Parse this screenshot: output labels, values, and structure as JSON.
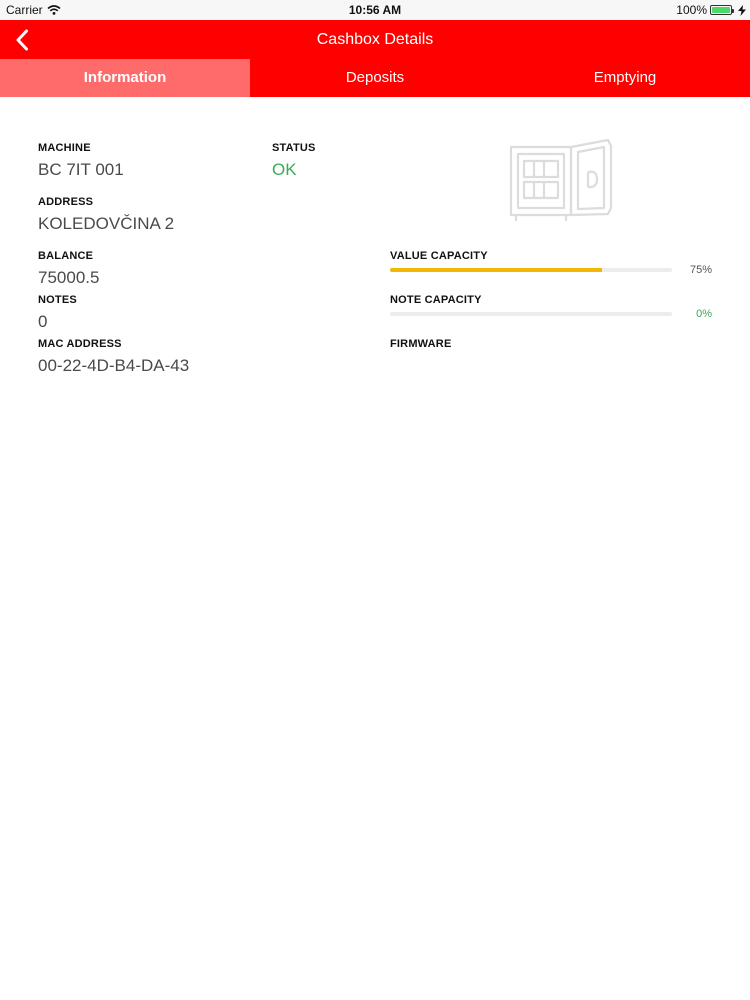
{
  "status_bar": {
    "carrier": "Carrier",
    "time": "10:56 AM",
    "battery": "100%"
  },
  "nav": {
    "title": "Cashbox Details"
  },
  "tabs": [
    {
      "label": "Information",
      "active": true
    },
    {
      "label": "Deposits",
      "active": false
    },
    {
      "label": "Emptying",
      "active": false
    }
  ],
  "info": {
    "machine_label": "MACHINE",
    "machine_value": "BC 7IT 001",
    "status_label": "STATUS",
    "status_value": "OK",
    "address_label": "ADDRESS",
    "address_value": "KOLEDOVČINA 2",
    "balance_label": "BALANCE",
    "balance_value": "75000.5",
    "notes_label": "NOTES",
    "notes_value": "0",
    "mac_label": "MAC ADDRESS",
    "mac_value": "00-22-4D-B4-DA-43",
    "value_capacity_label": "VALUE CAPACITY",
    "value_capacity_pct": "75%",
    "value_capacity_fraction": 0.75,
    "note_capacity_label": "NOTE CAPACITY",
    "note_capacity_pct": "0%",
    "note_capacity_fraction": 0,
    "firmware_label": "FIRMWARE"
  },
  "colors": {
    "brand_red": "#ff0000",
    "active_tab": "#ff6b6b",
    "status_ok": "#3bab5a",
    "progress": "#f2b705"
  },
  "icons": {
    "back": "chevron-left-icon",
    "safe": "safe-icon",
    "wifi": "wifi-icon",
    "battery": "battery-icon",
    "charging": "charging-bolt-icon"
  }
}
